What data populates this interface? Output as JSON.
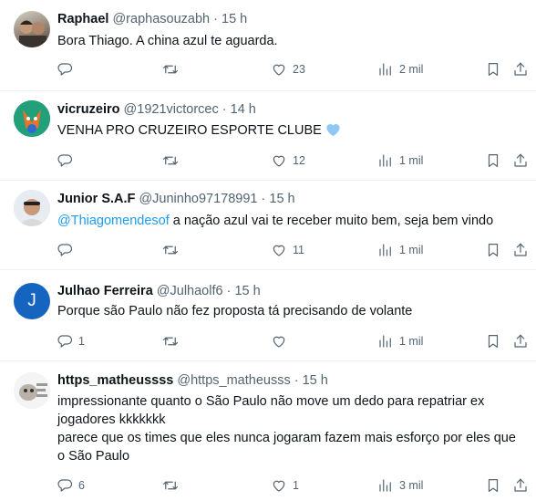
{
  "tweets": [
    {
      "name": "Raphael",
      "handle": "@raphasouzabh",
      "time": "15 h",
      "text": "Bora Thiago. A china azul te aguarda.",
      "replies": "",
      "retweets": "",
      "likes": "23",
      "views": "2 mil"
    },
    {
      "name": "vicruzeiro",
      "handle": "@1921victorcec",
      "time": "14 h",
      "text": "VENHA PRO CRUZEIRO ESPORTE CLUBE",
      "replies": "",
      "retweets": "",
      "likes": "12",
      "views": "1 mil"
    },
    {
      "name": "Junior S.A.F",
      "handle": "@Juninho97178991",
      "time": "15 h",
      "mention": "@Thiagomendesof",
      "text": " a nação azul vai te receber muito bem, seja bem vindo",
      "replies": "",
      "retweets": "",
      "likes": "11",
      "views": "1 mil"
    },
    {
      "name": "Julhao Ferreira",
      "handle": "@Julhaolf6",
      "time": "15 h",
      "avatar_letter": "J",
      "text": "Porque são Paulo não fez proposta tá precisando de volante",
      "replies": "1",
      "retweets": "",
      "likes": "",
      "views": "1 mil"
    },
    {
      "name": "https_matheussss",
      "handle": "@https_matheusss",
      "time": "15 h",
      "text_line1": "impressionante quanto o São Paulo não move um dedo para repatriar ex jogadores kkkkkkk",
      "text_line2": "parece que os times que eles nunca jogaram fazem mais esforço por eles que o São Paulo",
      "replies": "6",
      "retweets": "",
      "likes": "1",
      "views": "3 mil"
    }
  ],
  "separator": "·",
  "colors": {
    "text": "#0f1419",
    "secondary": "#536471",
    "link": "#1d9bf0",
    "avatar_blue": "#1565c0"
  },
  "icons": [
    "reply-icon",
    "retweet-icon",
    "like-icon",
    "views-icon",
    "bookmark-icon",
    "share-icon",
    "blue-heart-icon"
  ]
}
